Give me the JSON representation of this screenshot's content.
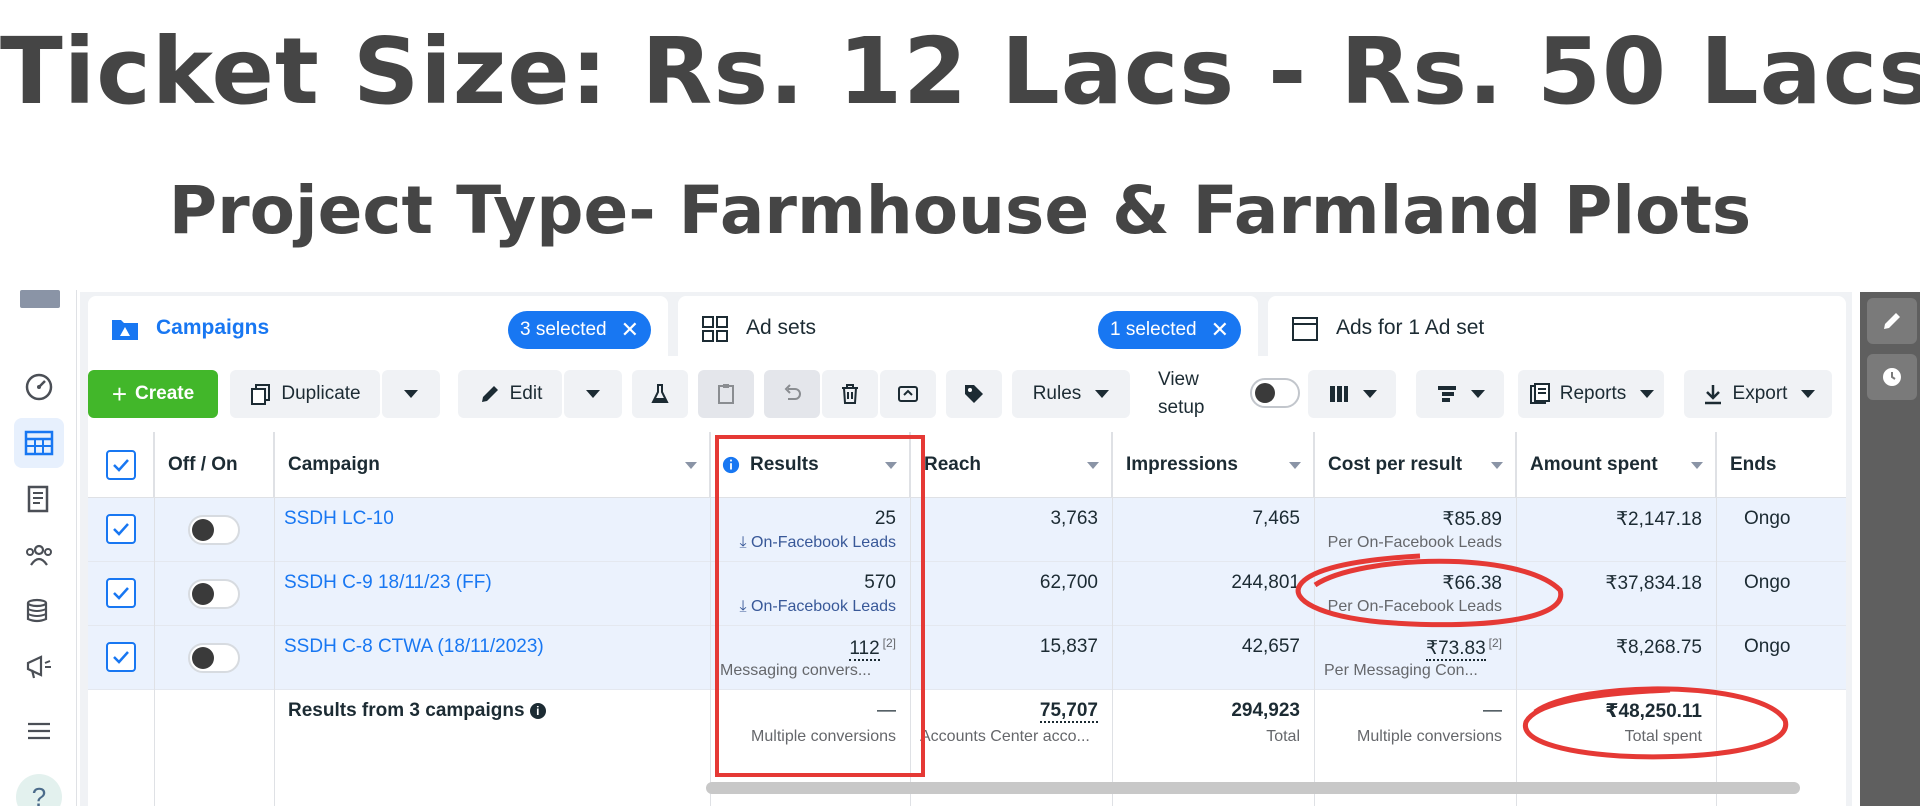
{
  "headline": "Ticket Size: Rs. 12 Lacs - Rs. 50 Lacs",
  "subheadline": "Project Type- Farmhouse & Farmland Plots",
  "tabs": [
    {
      "label": "Campaigns",
      "badge": "3 selected",
      "icon": "campaigns-folder-icon"
    },
    {
      "label": "Ad sets",
      "badge": "1 selected",
      "icon": "grid-icon"
    },
    {
      "label": "Ads for 1 Ad set",
      "icon": "window-icon"
    }
  ],
  "toolbar": {
    "create": "Create",
    "duplicate": "Duplicate",
    "edit": "Edit",
    "rules": "Rules",
    "view_setup": "View setup",
    "reports": "Reports",
    "export": "Export"
  },
  "columns": {
    "toggle": "Off / On",
    "campaign": "Campaign",
    "results": "Results",
    "reach": "Reach",
    "impressions": "Impressions",
    "cost_per_result": "Cost per result",
    "amount_spent": "Amount spent",
    "ends": "Ends"
  },
  "rows": [
    {
      "name": "SSDH LC-10",
      "results": "25",
      "results_sub": "On-Facebook Leads",
      "reach": "3,763",
      "impressions": "7,465",
      "cost_per_result": "₹85.89",
      "cost_sub": "Per On-Facebook Leads",
      "amount_spent": "₹2,147.18",
      "ends": "Ongo"
    },
    {
      "name": "SSDH C-9 18/11/23 (FF)",
      "results": "570",
      "results_sub": "On-Facebook Leads",
      "reach": "62,700",
      "impressions": "244,801",
      "cost_per_result": "₹66.38",
      "cost_sub": "Per On-Facebook Leads",
      "amount_spent": "₹37,834.18",
      "ends": "Ongo"
    },
    {
      "name": "SSDH C-8 CTWA (18/11/2023)",
      "results": "112",
      "results_note": "[2]",
      "results_sub": "Messaging convers...",
      "reach": "15,837",
      "impressions": "42,657",
      "cost_per_result": "₹73.83",
      "cost_note": "[2]",
      "cost_sub": "Per Messaging Con...",
      "amount_spent": "₹8,268.75",
      "ends": "Ongo"
    }
  ],
  "summary": {
    "label": "Results from 3 campaigns",
    "results": "—",
    "results_sub": "Multiple conversions",
    "reach": "75,707",
    "reach_sub": "Accounts Center acco...",
    "impressions": "294,923",
    "impressions_sub": "Total",
    "cost_per_result": "—",
    "cost_sub": "Multiple conversions",
    "amount_spent": "₹48,250.11",
    "amount_sub": "Total spent"
  },
  "colors": {
    "accent": "#1877f2",
    "create_green": "#42b72a",
    "annotation_red": "#e53935",
    "heading_gray": "#454545"
  }
}
